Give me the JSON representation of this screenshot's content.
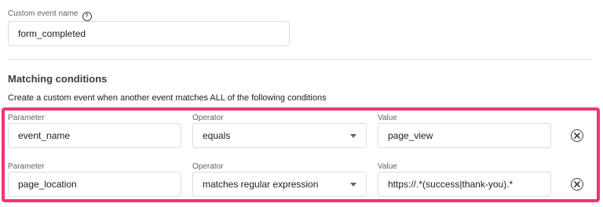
{
  "custom_event": {
    "label": "Custom event name",
    "help_icon": "help-circle-icon",
    "value": "form_completed"
  },
  "matching": {
    "title": "Matching conditions",
    "description": "Create a custom event when another event matches ALL of the following conditions",
    "highlight_color": "#f0366f",
    "conditions": [
      {
        "parameter_label": "Parameter",
        "parameter_value": "event_name",
        "operator_label": "Operator",
        "operator_value": "equals",
        "value_label": "Value",
        "value_value": "page_view",
        "remove_icon": "remove-circle-icon"
      },
      {
        "parameter_label": "Parameter",
        "parameter_value": "page_location",
        "operator_label": "Operator",
        "operator_value": "matches regular expression",
        "value_label": "Value",
        "value_value": "https://.*(success|thank-you).*",
        "remove_icon": "remove-circle-icon"
      }
    ]
  }
}
